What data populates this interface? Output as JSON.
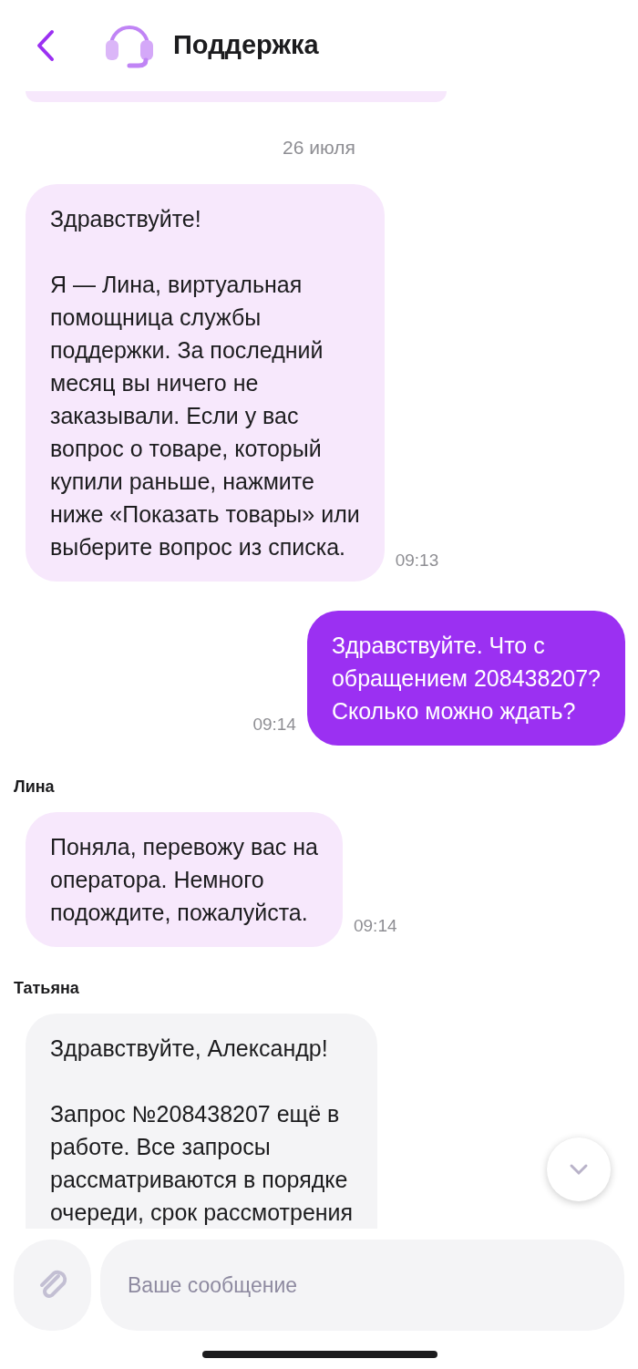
{
  "header": {
    "title": "Поддержка"
  },
  "date_separator": "26 июля",
  "messages": [
    {
      "kind": "bot",
      "text": "Здравствуйте!\n\nЯ — Лина, виртуальная\nпомощница службы\nподдержки. За последний\nмесяц вы ничего не\nзаказывали. Если у вас\nвопрос о товаре, который\nкупили раньше, нажмите\nниже «Показать товары» или\nвыберите вопрос из списка.",
      "time": "09:13"
    },
    {
      "kind": "user",
      "text": "Здравствуйте. Что с\nобращением 208438207?\nСколько можно ждать?",
      "time": "09:14"
    },
    {
      "kind": "bot",
      "sender": "Лина",
      "text": "Поняла, перевожу вас на\nоператора. Немного\nподождите, пожалуйста.",
      "time": "09:14"
    },
    {
      "kind": "operator",
      "sender": "Татьяна",
      "text": "Здравствуйте, Александр!\n\nЗапрос №208438207 ещё в\nработе. Все запросы\nрассматриваются в порядке\nочереди, срок рассмотрения"
    }
  ],
  "composer": {
    "placeholder": "Ваше сообщение"
  }
}
